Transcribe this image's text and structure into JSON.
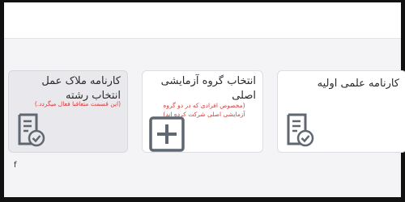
{
  "cards": [
    {
      "id": "initial-scientific-report",
      "title": "کارنامه علمی اولیه",
      "note": "",
      "icon": "report-check-icon",
      "selected": false
    },
    {
      "id": "main-test-group",
      "title": "انتخاب گروه آزمایشی اصلی",
      "note": "(مخصوص افرادی که در دو گروه آزمایشی اصلی شرکت کرده اند)",
      "icon": "add-square-icon",
      "selected": false
    },
    {
      "id": "criteria-report-major",
      "title": "کارنامه ملاک عمل انتخاب رشته",
      "note": "(این قسمت متعاقبا فعال میگردد.)",
      "icon": "report-check-icon",
      "selected": true
    }
  ],
  "misc_glyph": "f",
  "colors": {
    "note": "#d93a3a",
    "icon": "#5f6770",
    "selected_bg": "#e9e9ed"
  }
}
